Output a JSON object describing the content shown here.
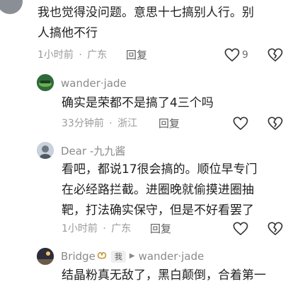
{
  "comments": [
    {
      "text_lines": [
        "我也觉得没问题。意思十七搞别人行。别",
        "人搞他不行"
      ],
      "time": "1小时前",
      "location": "广东",
      "reply_label": "回复",
      "like_count": "9",
      "avatar_color": "#8a8f96"
    },
    {
      "username": "wander·jade",
      "text_lines": [
        "确实是荣都不是搞了4三个吗"
      ],
      "time": "33分钟前",
      "location": "浙江",
      "reply_label": "回复",
      "avatar_color": "#2f6b3a"
    },
    {
      "username": "Dear -九九酱",
      "text_lines": [
        "看吧，都说17很会搞的。顺位早专门",
        "在必经路拦截。进圈晚就偷摸进圈抽",
        "靶，打法确实保守，但是不好看罢了"
      ],
      "time": "1小时前",
      "location": "广东",
      "reply_label": "回复",
      "avatar_color": "#a7b3c0"
    },
    {
      "username": "Bridge",
      "tag": "我",
      "reply_to": "wander·jade",
      "text_lines": [
        "结晶粉真无敌了，黑白颠倒，合着第一"
      ],
      "avatar_color": "#4a4a5a"
    }
  ],
  "separator": "·",
  "icons": [
    "heart-outline-icon",
    "broken-heart-icon"
  ],
  "colors": {
    "text": "#1f1f1f",
    "meta": "#9a9a9a",
    "icon": "#333333"
  }
}
